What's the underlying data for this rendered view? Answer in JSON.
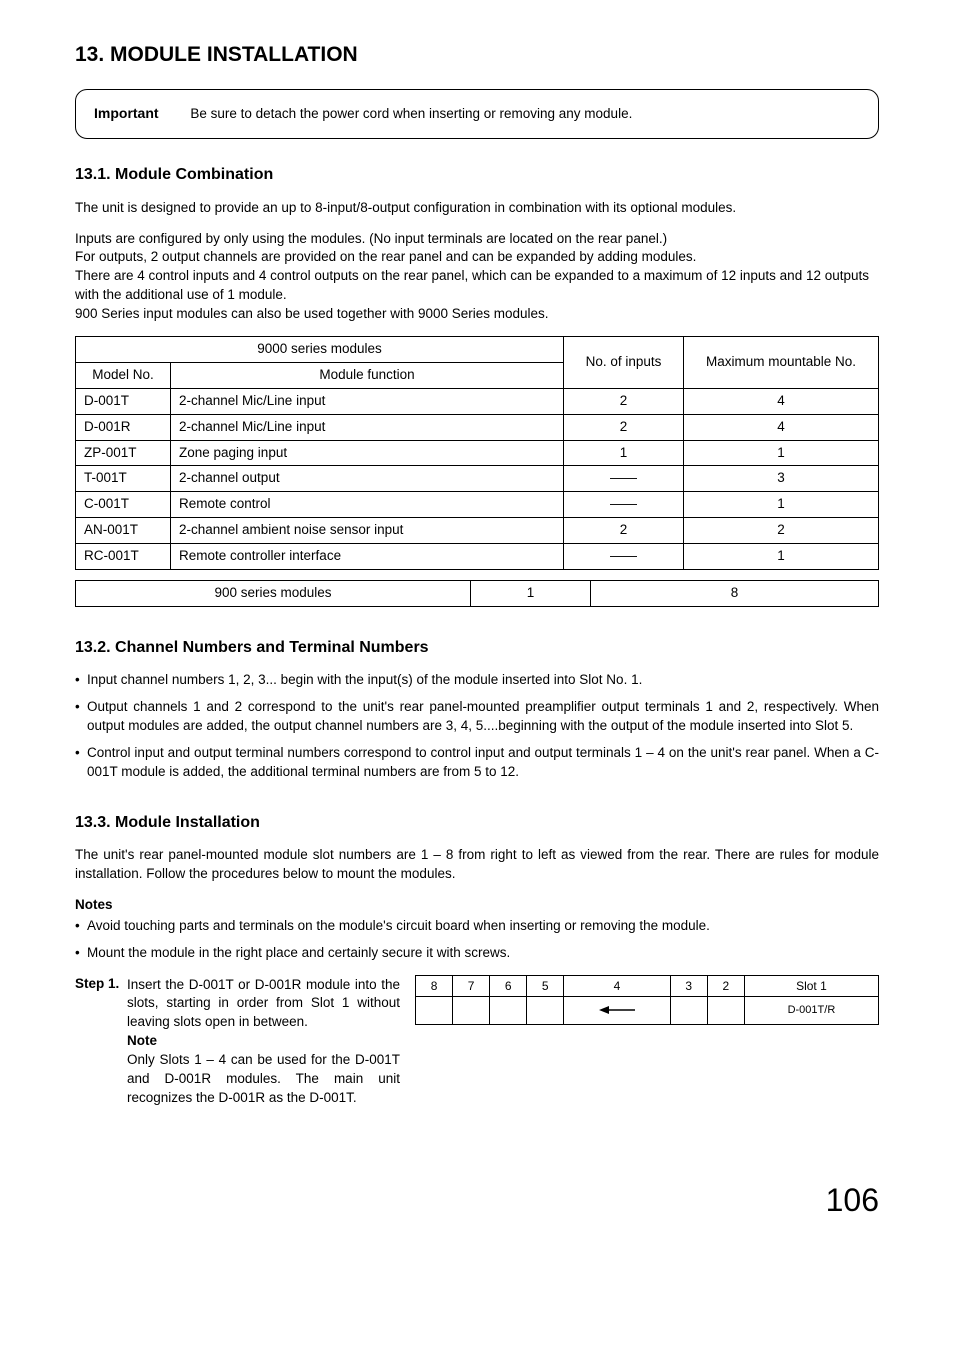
{
  "page_title": "13. MODULE INSTALLATION",
  "important": {
    "label": "Important",
    "text": "Be sure to detach the power cord when inserting or removing any module."
  },
  "section_131": {
    "heading": "13.1. Module Combination",
    "p1": "The unit is designed to provide an up to 8-input/8-output configuration in combination with its optional modules.",
    "p2": "Inputs are configured by only using the modules. (No input terminals are located on the rear panel.)",
    "p3": "For outputs, 2 output channels are provided on the rear panel and can be expanded by adding modules.",
    "p4": "There are 4 control inputs and 4 control outputs on the rear panel, which can be expanded to a maximum of 12 inputs and 12 outputs with the additional use of 1 module.",
    "p5": "900 Series input modules can also be used together with 9000 Series modules."
  },
  "table1": {
    "header_group": "9000 series modules",
    "col_model": "Model No.",
    "col_func": "Module function",
    "col_inputs": "No. of inputs",
    "col_max": "Maximum mountable No.",
    "rows": [
      {
        "model": "D-001T",
        "func": "2-channel Mic/Line input",
        "inputs": "2",
        "max": "4"
      },
      {
        "model": "D-001R",
        "func": "2-channel Mic/Line input",
        "inputs": "2",
        "max": "4"
      },
      {
        "model": "ZP-001T",
        "func": "Zone paging input",
        "inputs": "1",
        "max": "1"
      },
      {
        "model": "T-001T",
        "func": "2-channel output",
        "inputs": "——",
        "max": "3"
      },
      {
        "model": "C-001T",
        "func": "Remote control",
        "inputs": "——",
        "max": "1"
      },
      {
        "model": "AN-001T",
        "func": "2-channel ambient noise sensor input",
        "inputs": "2",
        "max": "2"
      },
      {
        "model": "RC-001T",
        "func": "Remote controller interface",
        "inputs": "——",
        "max": "1"
      }
    ]
  },
  "table2": {
    "label": "900 series modules",
    "inputs": "1",
    "max": "8"
  },
  "section_132": {
    "heading": "13.2. Channel Numbers and Terminal Numbers",
    "bullets": [
      "Input channel numbers 1, 2, 3... begin with the input(s) of the module inserted into Slot No. 1.",
      "Output channels 1 and 2 correspond to the unit's rear panel-mounted preamplifier output terminals 1 and 2, respectively. When output modules are added, the output channel numbers are 3, 4, 5....beginning with the output of the module inserted into Slot 5.",
      "Control input and output terminal numbers correspond to control input and output terminals 1 – 4 on the unit's rear panel. When a C-001T module is added, the additional terminal numbers are from 5 to 12."
    ]
  },
  "section_133": {
    "heading": "13.3. Module Installation",
    "p1": "The unit's rear panel-mounted module slot numbers are 1 – 8 from right to left as viewed from the rear. There are rules for module installation. Follow the procedures below to mount the modules.",
    "notes_heading": "Notes",
    "notes": [
      "Avoid touching parts and terminals on the module's circuit board when inserting or removing the module.",
      "Mount the module in the right place and certainly secure it with screws."
    ],
    "step1_label": "Step 1.",
    "step1_text": "Insert the D-001T or D-001R module into the slots, starting in order from Slot 1 without leaving slots open in between.",
    "step1_note_label": "Note",
    "step1_note_text": "Only Slots 1 – 4 can be used for the D-001T and D-001R modules. The main unit recognizes the D-001R as the D-001T."
  },
  "slot_diagram": {
    "headers": [
      "8",
      "7",
      "6",
      "5",
      "4",
      "3",
      "2",
      "Slot 1"
    ],
    "cell_label": "D-001T/R"
  },
  "page_number": "106"
}
